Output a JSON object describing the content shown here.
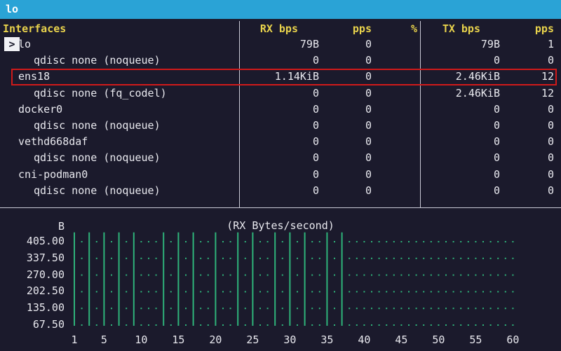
{
  "window": {
    "title": "lo"
  },
  "table": {
    "headers": {
      "interfaces": "Interfaces",
      "rx_bps": "RX bps",
      "rx_pps": "pps",
      "pct": "%",
      "tx_bps": "TX bps",
      "tx_pps": "pps"
    },
    "cursor_symbol": ">",
    "rows": [
      {
        "name": "lo",
        "indent": false,
        "rx_bps": "79B",
        "rx_pps": "0",
        "tx_bps": "79B",
        "tx_pps": "1"
      },
      {
        "name": "qdisc none (noqueue)",
        "indent": true,
        "rx_bps": "0",
        "rx_pps": "0",
        "tx_bps": "0",
        "tx_pps": "0"
      },
      {
        "name": "ens18",
        "indent": false,
        "rx_bps": "1.14KiB",
        "rx_pps": "0",
        "tx_bps": "2.46KiB",
        "tx_pps": "12"
      },
      {
        "name": "qdisc none (fq_codel)",
        "indent": true,
        "rx_bps": "0",
        "rx_pps": "0",
        "tx_bps": "2.46KiB",
        "tx_pps": "12"
      },
      {
        "name": "docker0",
        "indent": false,
        "rx_bps": "0",
        "rx_pps": "0",
        "tx_bps": "0",
        "tx_pps": "0"
      },
      {
        "name": "qdisc none (noqueue)",
        "indent": true,
        "rx_bps": "0",
        "rx_pps": "0",
        "tx_bps": "0",
        "tx_pps": "0"
      },
      {
        "name": "vethd668daf",
        "indent": false,
        "rx_bps": "0",
        "rx_pps": "0",
        "tx_bps": "0",
        "tx_pps": "0"
      },
      {
        "name": "qdisc none (noqueue)",
        "indent": true,
        "rx_bps": "0",
        "rx_pps": "0",
        "tx_bps": "0",
        "tx_pps": "0"
      },
      {
        "name": "cni-podman0",
        "indent": false,
        "rx_bps": "0",
        "rx_pps": "0",
        "tx_bps": "0",
        "tx_pps": "0"
      },
      {
        "name": "qdisc none (noqueue)",
        "indent": true,
        "rx_bps": "0",
        "rx_pps": "0",
        "tx_bps": "0",
        "tx_pps": "0"
      }
    ]
  },
  "graph": {
    "unit_label": "B",
    "title": "(RX Bytes/second)",
    "y_ticks": [
      "405.00",
      "337.50",
      "270.00",
      "202.50",
      "135.00",
      "67.50"
    ],
    "x_ticks": [
      "1",
      "5",
      "10",
      "15",
      "20",
      "25",
      "30",
      "35",
      "40",
      "45",
      "50",
      "55",
      "60"
    ],
    "bar_color": "#2fb37a"
  },
  "chart_data": {
    "type": "bar",
    "title": "(RX Bytes/second)",
    "ylabel": "B",
    "ylim": [
      0,
      405
    ],
    "x": [
      1,
      2,
      3,
      4,
      5,
      6,
      7,
      8,
      9,
      10,
      11,
      12,
      13,
      14,
      15,
      16,
      17,
      18,
      19,
      20,
      21,
      22,
      23,
      24,
      25,
      26,
      27,
      28,
      29,
      30,
      31,
      32,
      33,
      34,
      35,
      36,
      37,
      38,
      39,
      40,
      41,
      42,
      43,
      44,
      45,
      46,
      47,
      48,
      49,
      50,
      51,
      52,
      53,
      54,
      55,
      56,
      57,
      58,
      59,
      60
    ],
    "values": [
      400,
      0,
      400,
      0,
      400,
      0,
      400,
      0,
      400,
      0,
      0,
      0,
      400,
      0,
      400,
      0,
      400,
      0,
      0,
      400,
      0,
      0,
      400,
      0,
      400,
      0,
      0,
      400,
      0,
      400,
      0,
      400,
      0,
      0,
      400,
      0,
      400,
      0,
      0,
      0,
      0,
      0,
      0,
      0,
      0,
      0,
      0,
      0,
      0,
      0,
      0,
      0,
      0,
      0,
      0,
      0,
      0,
      0,
      0,
      0
    ]
  }
}
